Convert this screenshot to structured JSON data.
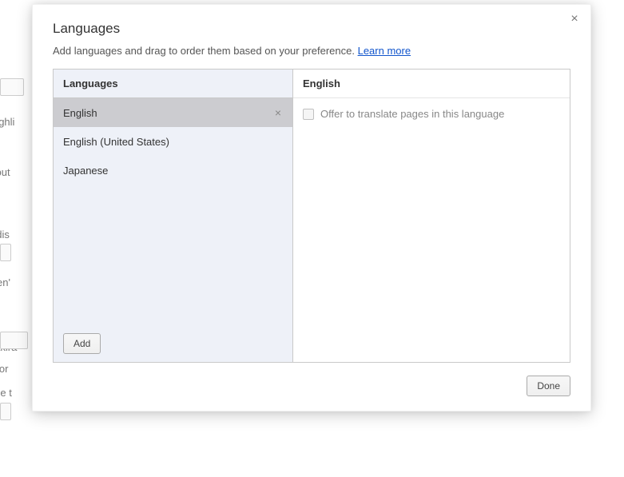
{
  "dialog": {
    "title": "Languages",
    "description_prefix": "Add languages and drag to order them based on your preference. ",
    "learn_more": "Learn more",
    "close_glyph": "×"
  },
  "left": {
    "header": "Languages",
    "add_label": "Add",
    "items": [
      {
        "label": "English",
        "selected": true
      },
      {
        "label": "English (United States)",
        "selected": false
      },
      {
        "label": "Japanese",
        "selected": false
      }
    ],
    "remove_glyph": "×"
  },
  "right": {
    "header": "English",
    "translate_option": "Offer to translate pages in this language"
  },
  "footer": {
    "done_label": "Done"
  },
  "backdrop": {
    "t0": "ge highli",
    "t1": "comput",
    "t2": " and dis",
    "t3": "at aren'",
    "t4": "zekiakira",
    "t5": "e befor",
    "t6": "ain file t"
  }
}
